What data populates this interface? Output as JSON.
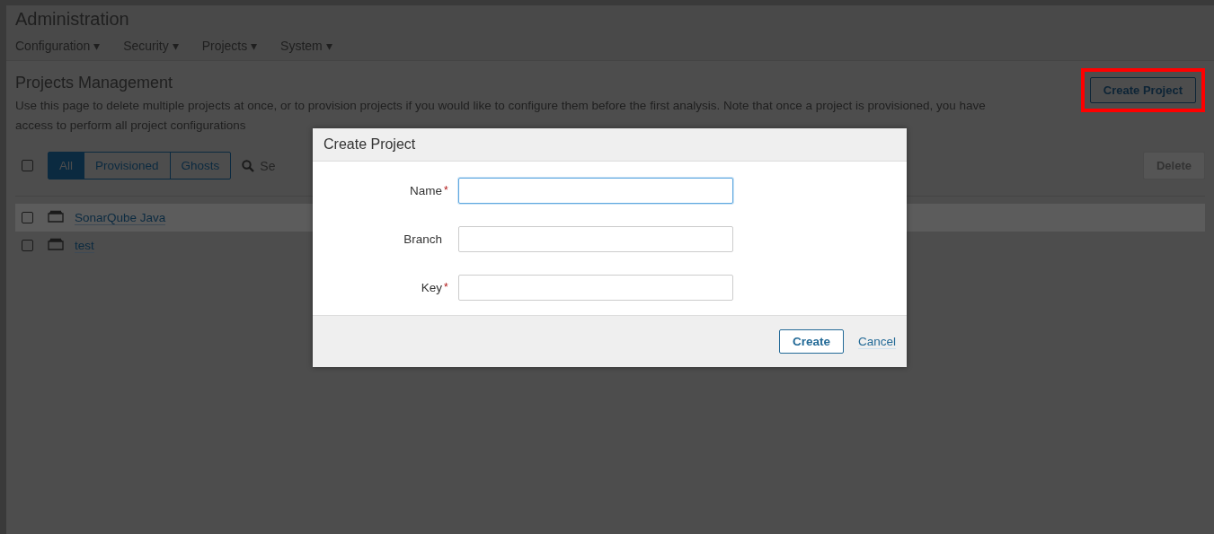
{
  "header": {
    "title": "Administration",
    "menu": [
      {
        "label": "Configuration",
        "caret": "▾"
      },
      {
        "label": "Security",
        "caret": "▾"
      },
      {
        "label": "Projects",
        "caret": "▾"
      },
      {
        "label": "System",
        "caret": "▾"
      }
    ]
  },
  "page": {
    "title": "Projects Management",
    "description": "Use this page to delete multiple projects at once, or to provision projects if you would like to configure them before the first analysis. Note that once a project is provisioned, you have access to perform all project configurations",
    "create_button": {
      "label": "Create Project",
      "highlighted": true
    }
  },
  "filters": [
    {
      "label": "All",
      "selected": true
    },
    {
      "label": "Provisioned",
      "selected": false
    },
    {
      "label": "Ghosts",
      "selected": false
    }
  ],
  "select_all": {
    "checked": false
  },
  "search": {
    "placeholder": "Se"
  },
  "delete_button": {
    "label": "Delete",
    "disabled": true
  },
  "projects": [
    {
      "name": "SonarQube Java",
      "checked": false,
      "hovered": true
    },
    {
      "name": "test",
      "checked": false,
      "hovered": false
    }
  ],
  "dialog": {
    "title": "Create Project",
    "fields": [
      {
        "label": "Name",
        "required": true,
        "focused": true
      },
      {
        "label": "Branch",
        "required": false,
        "focused": false
      },
      {
        "label": "Key",
        "required": true,
        "focused": false
      }
    ],
    "required_mark": "*",
    "create_label": "Create",
    "cancel_label": "Cancel"
  }
}
